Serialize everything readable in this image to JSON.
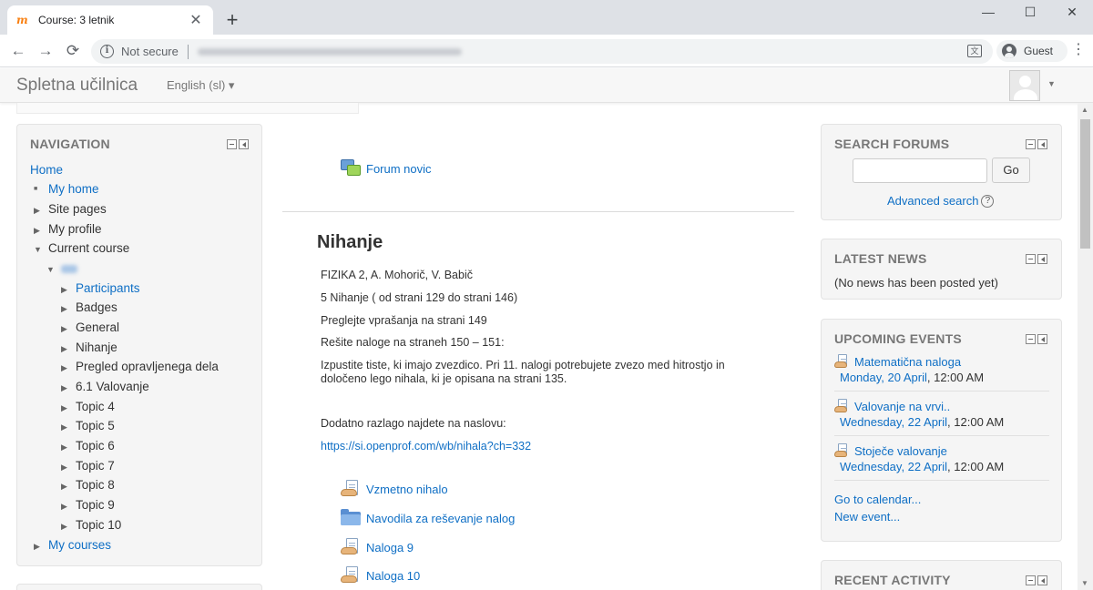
{
  "browser": {
    "tab_title": "Course: 3 letnik",
    "tab_favicon": "m",
    "new_tab": "+",
    "close": "✕",
    "minimize": "—",
    "maximize": "☐",
    "window_close": "✕",
    "back": "←",
    "forward": "→",
    "reload": "⟳",
    "info": "i",
    "not_secure": "Not secure",
    "translate": "文",
    "profile": "Guest",
    "menu": "⋮"
  },
  "site": {
    "brand": "Spletna učilnica",
    "language": "English (sl) ▾",
    "user_caret": "▼"
  },
  "navigation": {
    "title": "NAVIGATION",
    "home": "Home",
    "my_home": "My home",
    "site_pages": "Site pages",
    "my_profile": "My profile",
    "current_course": "Current course",
    "course_items": [
      "Participants",
      "Badges",
      "General",
      "Nihanje",
      "Pregled opravljenega dela",
      "6.1 Valovanje",
      "Topic 4",
      "Topic 5",
      "Topic 6",
      "Topic 7",
      "Topic 8",
      "Topic 9",
      "Topic 10"
    ],
    "my_courses": "My courses"
  },
  "main": {
    "forum": "Forum novic",
    "section_title": "Nihanje",
    "lines": [
      "FIZIKA 2, A. Mohorič, V. Babič",
      "5 Nihanje ( od strani 129 do strani  146)",
      "Preglejte vprašanja na strani 149",
      "Rešite naloge na straneh 150 – 151:"
    ],
    "paragraph": "Izpustite tiste, ki imajo zvezdico. Pri 11. nalogi potrebujete zvezo med hitrostjo in določeno lego nihala, ki je opisana na strani 135.",
    "extra": "Dodatno razlago najdete na naslovu:",
    "url": "https://si.openprof.com/wb/nihala?ch=332",
    "activities": [
      "Vzmetno nihalo",
      "Navodila za reševanje nalog",
      "Naloga 9",
      "Naloga 10"
    ]
  },
  "search_forums": {
    "title": "SEARCH FORUMS",
    "go": "Go",
    "advanced": "Advanced search",
    "help": "?"
  },
  "latest_news": {
    "title": "LATEST NEWS",
    "empty": "(No news has been posted yet)"
  },
  "upcoming_events": {
    "title": "UPCOMING EVENTS",
    "events": [
      {
        "name": "Matematična naloga",
        "date": "Monday, 20 April",
        "time": ", 12:00 AM"
      },
      {
        "name": "Valovanje na vrvi..",
        "date": "Wednesday, 22 April",
        "time": ", 12:00 AM"
      },
      {
        "name": "Stoječe valovanje",
        "date": "Wednesday, 22 April",
        "time": ", 12:00 AM"
      }
    ],
    "calendar": "Go to calendar...",
    "new_event": "New event..."
  },
  "recent_activity": {
    "title": "RECENT ACTIVITY"
  },
  "icons": {
    "arrow_right": "▶",
    "arrow_down": "▼",
    "bullet": "■",
    "scroll_up": "▲",
    "scroll_down": "▼"
  }
}
